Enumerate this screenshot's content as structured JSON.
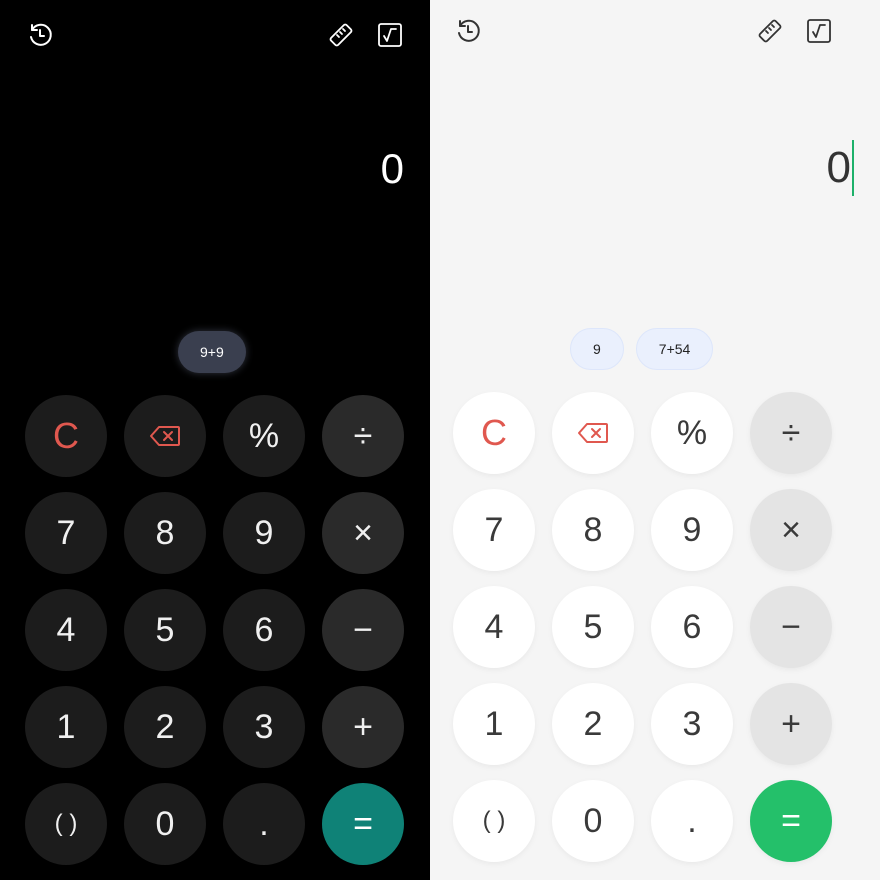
{
  "panels": [
    {
      "theme": "dark",
      "display": {
        "value": "0"
      },
      "chips": [
        "9+9"
      ],
      "accent_equals": "#0f8277"
    },
    {
      "theme": "light",
      "display": {
        "value": "0"
      },
      "chips": [
        "9",
        "7+54"
      ],
      "accent_equals": "#24c06a"
    }
  ],
  "toolbar": {
    "history_icon": "history-icon",
    "ruler_icon": "ruler-icon",
    "sqrt_icon": "square-root-icon"
  },
  "keys": {
    "clear": "C",
    "percent": "%",
    "divide": "÷",
    "multiply": "×",
    "minus": "−",
    "plus": "+",
    "parens": "( )",
    "dot": ".",
    "equals": "=",
    "digits": [
      "0",
      "1",
      "2",
      "3",
      "4",
      "5",
      "6",
      "7",
      "8",
      "9"
    ]
  },
  "colors": {
    "clear_red": "#e0584f",
    "cursor_green": "#1db16a"
  }
}
